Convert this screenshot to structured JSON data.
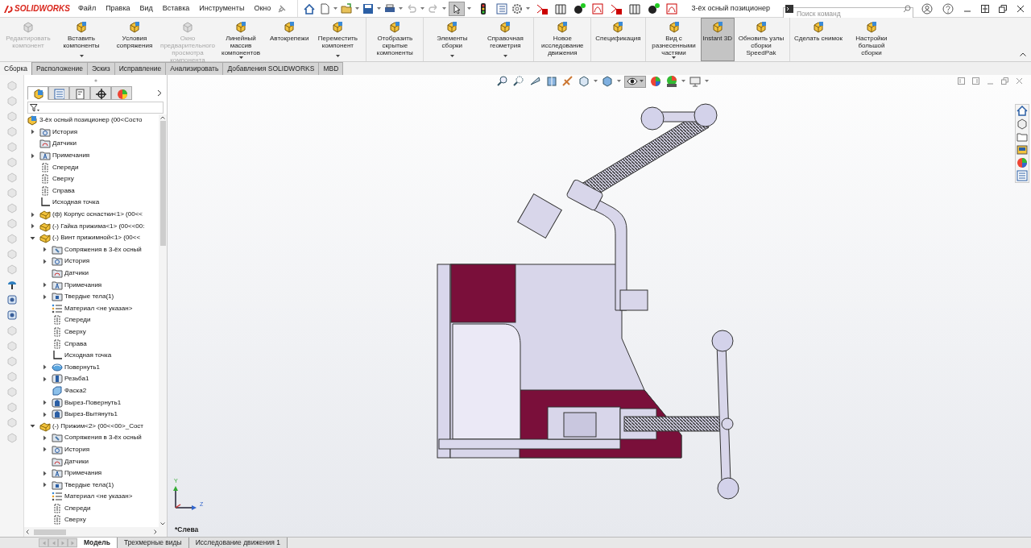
{
  "app": {
    "logo": "SOLIDWORKS",
    "title": "3-ёх осный позиционер"
  },
  "menu": [
    "Файл",
    "Правка",
    "Вид",
    "Вставка",
    "Инструменты",
    "Окно"
  ],
  "quick_toolbar": {
    "select_active": true
  },
  "search": {
    "placeholder": "Поиск команд"
  },
  "ribbon_groups": [
    [
      {
        "label": "Редактировать компонент",
        "disabled": true,
        "dropdown": false,
        "selected": false
      },
      {
        "label": "Вставить компоненты",
        "disabled": false,
        "dropdown": true,
        "selected": false
      },
      {
        "label": "Условия сопряжения",
        "disabled": false,
        "dropdown": false,
        "selected": false
      },
      {
        "label": "Окно предварительного просмотра компонента",
        "disabled": true,
        "dropdown": false,
        "selected": false
      },
      {
        "label": "Линейный массив компонентов",
        "disabled": false,
        "dropdown": true,
        "selected": false
      },
      {
        "label": "Автокрепежи",
        "disabled": false,
        "dropdown": false,
        "selected": false
      },
      {
        "label": "Переместить компонент",
        "disabled": false,
        "dropdown": true,
        "selected": false
      }
    ],
    [
      {
        "label": "Отобразить скрытые компоненты",
        "disabled": false,
        "dropdown": false,
        "selected": false
      }
    ],
    [
      {
        "label": "Элементы сборки",
        "disabled": false,
        "dropdown": true,
        "selected": false
      },
      {
        "label": "Справочная геометрия",
        "disabled": false,
        "dropdown": true,
        "selected": false
      }
    ],
    [
      {
        "label": "Новое исследование движения",
        "disabled": false,
        "dropdown": false,
        "selected": false
      }
    ],
    [
      {
        "label": "Спецификация",
        "disabled": false,
        "dropdown": false,
        "selected": false
      }
    ],
    [
      {
        "label": "Вид с разнесенными частями",
        "disabled": false,
        "dropdown": true,
        "selected": false
      },
      {
        "label": "Instant 3D",
        "disabled": false,
        "dropdown": false,
        "selected": true
      },
      {
        "label": "Обновить узлы сборки SpeedPak",
        "disabled": false,
        "dropdown": false,
        "selected": false
      }
    ],
    [
      {
        "label": "Сделать снимок",
        "disabled": false,
        "dropdown": false,
        "selected": false
      },
      {
        "label": "Настройки большой сборки",
        "disabled": false,
        "dropdown": false,
        "selected": false
      }
    ]
  ],
  "tabs": [
    {
      "label": "Сборка",
      "selected": true
    },
    {
      "label": "Расположение",
      "selected": false
    },
    {
      "label": "Эскиз",
      "selected": false
    },
    {
      "label": "Исправление",
      "selected": false
    },
    {
      "label": "Анализировать",
      "selected": false
    },
    {
      "label": "Добавления SOLIDWORKS",
      "selected": false
    },
    {
      "label": "MBD",
      "selected": false
    }
  ],
  "panel_tabs": [
    {
      "selected": true
    },
    {
      "selected": false
    },
    {
      "selected": false
    },
    {
      "selected": false
    },
    {
      "selected": false
    }
  ],
  "tree": {
    "text": "3-ёх осный позиционер  (00<Состо",
    "kind": "assembly",
    "children": [
      {
        "text": "История",
        "kind": "history",
        "expanded": false
      },
      {
        "text": "Датчики",
        "kind": "sensor"
      },
      {
        "text": "Примечания",
        "kind": "notes",
        "expanded": false
      },
      {
        "text": "Спереди",
        "kind": "plane"
      },
      {
        "text": "Сверху",
        "kind": "plane"
      },
      {
        "text": "Справа",
        "kind": "plane"
      },
      {
        "text": "Исходная точка",
        "kind": "origin"
      },
      {
        "text": "(ф) Корпус оснастки<1> (00<<",
        "kind": "part",
        "expanded": false
      },
      {
        "text": "(-) Гайка прижима<1> (00<<00:",
        "kind": "part",
        "expanded": false
      },
      {
        "text": "(-) Винт прижимной<1> (00<<",
        "kind": "part",
        "expanded": true,
        "children": [
          {
            "text": "Сопряжения в 3-ёх осный",
            "kind": "mates",
            "expanded": false
          },
          {
            "text": "История",
            "kind": "history",
            "expanded": false
          },
          {
            "text": "Датчики",
            "kind": "sensor"
          },
          {
            "text": "Примечания",
            "kind": "notes",
            "expanded": false
          },
          {
            "text": "Твердые тела(1)",
            "kind": "bodies",
            "expanded": false
          },
          {
            "text": "Материал <не указан>",
            "kind": "material"
          },
          {
            "text": "Спереди",
            "kind": "plane"
          },
          {
            "text": "Сверху",
            "kind": "plane"
          },
          {
            "text": "Справа",
            "kind": "plane"
          },
          {
            "text": "Исходная точка",
            "kind": "origin"
          },
          {
            "text": "Повернуть1",
            "kind": "revolve",
            "expanded": false
          },
          {
            "text": "Резьба1",
            "kind": "thread",
            "expanded": false
          },
          {
            "text": "Фаска2",
            "kind": "chamfer"
          },
          {
            "text": "Вырез-Повернуть1",
            "kind": "cut",
            "expanded": false
          },
          {
            "text": "Вырез-Вытянуть1",
            "kind": "cut",
            "expanded": false
          }
        ]
      },
      {
        "text": "(-) Прижим<2> (00<<00>_Сост",
        "kind": "part",
        "expanded": true,
        "children": [
          {
            "text": "Сопряжения в 3-ёх осный",
            "kind": "mates",
            "expanded": false
          },
          {
            "text": "История",
            "kind": "history",
            "expanded": false
          },
          {
            "text": "Датчики",
            "kind": "sensor"
          },
          {
            "text": "Примечания",
            "kind": "notes",
            "expanded": false
          },
          {
            "text": "Твердые тела(1)",
            "kind": "bodies",
            "expanded": false
          },
          {
            "text": "Материал <не указан>",
            "kind": "material"
          },
          {
            "text": "Спереди",
            "kind": "plane"
          },
          {
            "text": "Сверху",
            "kind": "plane"
          }
        ]
      }
    ]
  },
  "viewport": {
    "view_name": "*Слева",
    "triad": {
      "y": "Y",
      "z": "Z"
    },
    "display_style_active": true
  },
  "bottom_tabs": [
    {
      "label": "Модель",
      "selected": true
    },
    {
      "label": "Трехмерные виды",
      "selected": false
    },
    {
      "label": "Исследование движения 1",
      "selected": false
    }
  ]
}
